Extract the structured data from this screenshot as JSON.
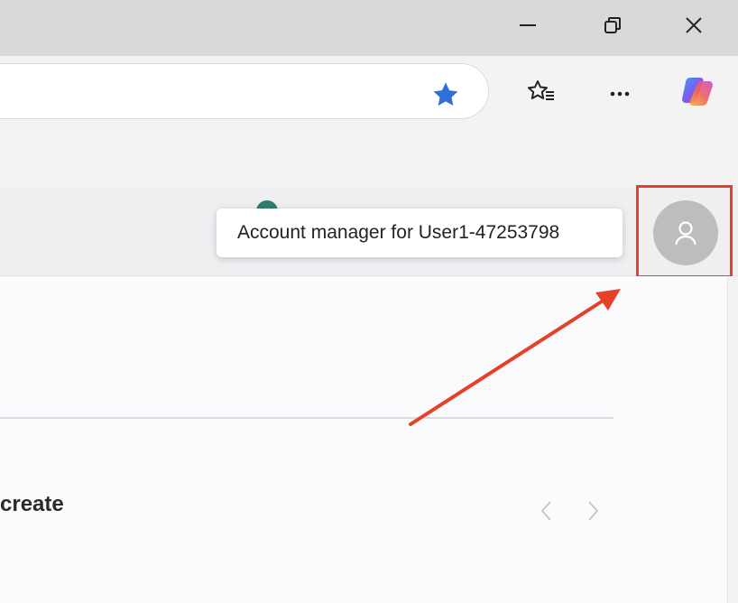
{
  "window": {
    "controls": [
      "minimize-icon",
      "restore-icon",
      "close-icon"
    ]
  },
  "toolbar": {
    "favorite_star_color": "#2f6fd6",
    "buttons": [
      "favorites-icon",
      "more-icon",
      "copilot-icon"
    ]
  },
  "profile": {
    "tooltip": "Account manager for User1-47253798",
    "avatar_color": "#bdbdbd",
    "highlight_color": "#e5412a"
  },
  "content": {
    "section_title": "create"
  }
}
